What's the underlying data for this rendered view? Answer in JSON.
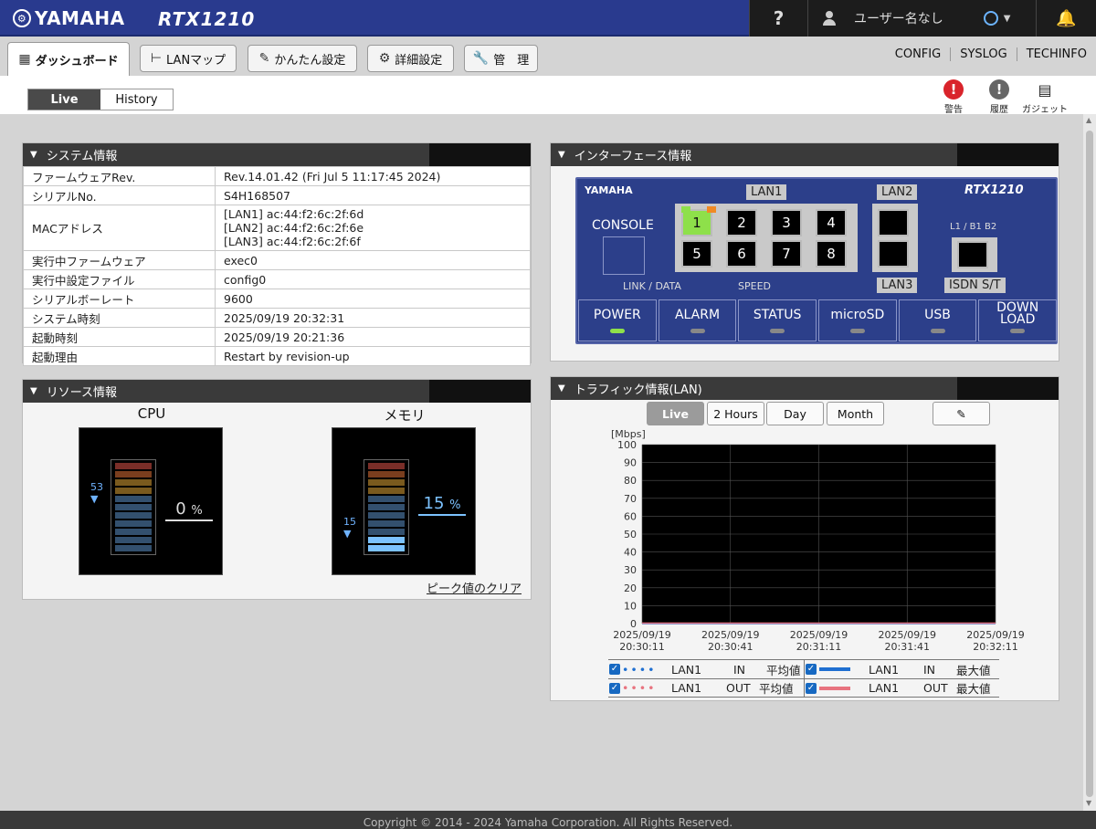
{
  "header": {
    "brand": "YAMAHA",
    "model": "RTX1210",
    "help": "?",
    "user_label": "ユーザー名なし"
  },
  "nav": {
    "tabs": [
      {
        "label": "ダッシュボード",
        "icon": "dashboard-icon"
      },
      {
        "label": "LANマップ",
        "icon": "lan-map-icon"
      },
      {
        "label": "かんたん設定",
        "icon": "wand-icon"
      },
      {
        "label": "詳細設定",
        "icon": "gear-icon"
      },
      {
        "label": "管　理",
        "icon": "wrench-icon"
      }
    ],
    "links": [
      "CONFIG",
      "SYSLOG",
      "TECHINFO"
    ]
  },
  "subbar": {
    "live": "Live",
    "history": "History",
    "tools": [
      "警告",
      "履歴",
      "ガジェット"
    ]
  },
  "system": {
    "title": "システム情報",
    "rows": [
      {
        "k": "ファームウェアRev.",
        "v": "Rev.14.01.42 (Fri Jul 5 11:17:45 2024)"
      },
      {
        "k": "シリアルNo.",
        "v": "S4H168507"
      },
      {
        "k": "実行中ファームウェア",
        "v": "exec0"
      },
      {
        "k": "実行中設定ファイル",
        "v": "config0"
      },
      {
        "k": "シリアルボーレート",
        "v": "9600"
      },
      {
        "k": "システム時刻",
        "v": "2025/09/19 20:32:31"
      },
      {
        "k": "起動時刻",
        "v": "2025/09/19 20:21:36"
      },
      {
        "k": "起動理由",
        "v": "Restart by revision-up"
      }
    ],
    "mac_label": "MACアドレス",
    "mac": [
      "[LAN1] ac:44:f2:6c:2f:6d",
      "[LAN2] ac:44:f2:6c:2f:6e",
      "[LAN3] ac:44:f2:6c:2f:6f"
    ]
  },
  "resource": {
    "title": "リソース情報",
    "cpu": {
      "label": "CPU",
      "peak": "53",
      "value": "0",
      "unit": "%"
    },
    "mem": {
      "label": "メモリ",
      "peak": "15",
      "value": "15",
      "unit": "%"
    },
    "clear": "ピーク値のクリア"
  },
  "interface": {
    "title": "インターフェース情報",
    "brand": "YAMAHA",
    "model": "RTX1210",
    "console": "CONSOLE",
    "lan1": "LAN1",
    "lan2": "LAN2",
    "lan3": "LAN3",
    "isdn": "ISDN S/T",
    "isdn_top": "L1 / B1 B2",
    "linkdata": "LINK / DATA",
    "speed": "SPEED",
    "ports": [
      "1",
      "2",
      "3",
      "4",
      "5",
      "6",
      "7",
      "8"
    ],
    "leds": [
      "POWER",
      "ALARM",
      "STATUS",
      "microSD",
      "USB",
      "DOWN LOAD"
    ],
    "active_color": "#8ee04a"
  },
  "traffic": {
    "title": "トラフィック情報(LAN)",
    "buttons": [
      "Live",
      "2 Hours",
      "Day",
      "Month"
    ],
    "legend": [
      {
        "if": "LAN1",
        "dir": "IN",
        "stat": "平均値"
      },
      {
        "if": "LAN1",
        "dir": "IN",
        "stat": "最大値"
      },
      {
        "if": "LAN1",
        "dir": "OUT",
        "stat": "平均値"
      },
      {
        "if": "LAN1",
        "dir": "OUT",
        "stat": "最大値"
      }
    ]
  },
  "chart_data": {
    "type": "line",
    "ylabel": "[Mbps]",
    "ylim": [
      0,
      100
    ],
    "yticks": [
      0,
      10,
      20,
      30,
      40,
      50,
      60,
      70,
      80,
      90,
      100
    ],
    "x": [
      "2025/09/19 20:30:11",
      "2025/09/19 20:30:41",
      "2025/09/19 20:31:11",
      "2025/09/19 20:31:41",
      "2025/09/19 20:32:11"
    ],
    "series": [
      {
        "values": [
          0,
          0,
          0,
          0,
          0
        ],
        "color": "#1f6fd1"
      },
      {
        "values": [
          0,
          0,
          0,
          0,
          0
        ],
        "color": "#e8737f"
      }
    ],
    "background": "#000000",
    "grid": true
  },
  "footer": "Copyright © 2014 - 2024 Yamaha Corporation. All Rights Reserved."
}
